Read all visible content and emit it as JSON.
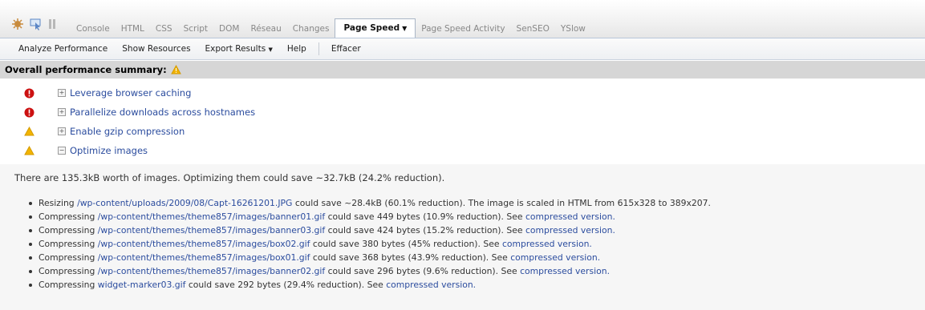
{
  "tabs": [
    "Console",
    "HTML",
    "CSS",
    "Script",
    "DOM",
    "Réseau",
    "Changes",
    "Page Speed",
    "Page Speed Activity",
    "SenSEO",
    "YSlow"
  ],
  "active_tab": "Page Speed",
  "toolbar": [
    "Analyze Performance",
    "Show Resources",
    "Export Results",
    "Help",
    "Effacer"
  ],
  "summary": {
    "title": "Overall performance summary:"
  },
  "rules": [
    {
      "label": "Leverage browser caching",
      "severity": "error",
      "expanded": false
    },
    {
      "label": "Parallelize downloads across hostnames",
      "severity": "error",
      "expanded": false
    },
    {
      "label": "Enable gzip compression",
      "severity": "warning",
      "expanded": false
    },
    {
      "label": "Optimize images",
      "severity": "warning",
      "expanded": true
    }
  ],
  "details": {
    "lead": "There are 135.3kB worth of images. Optimizing them could save ~32.7kB (24.2% reduction).",
    "items": [
      {
        "action": "Resizing",
        "path": "/wp-content/uploads/2009/08/Capt-16261201.JPG",
        "text": "could save ~28.4kB (60.1% reduction). The image is scaled in HTML from 615x328 to 389x207.",
        "link": ""
      },
      {
        "action": "Compressing",
        "path": "/wp-content/themes/theme857/images/banner01.gif",
        "text": "could save 449 bytes (10.9% reduction). See",
        "link": "compressed version."
      },
      {
        "action": "Compressing",
        "path": "/wp-content/themes/theme857/images/banner03.gif",
        "text": "could save 424 bytes (15.2% reduction). See",
        "link": "compressed version."
      },
      {
        "action": "Compressing",
        "path": "/wp-content/themes/theme857/images/box02.gif",
        "text": "could save 380 bytes (45% reduction). See",
        "link": "compressed version."
      },
      {
        "action": "Compressing",
        "path": "/wp-content/themes/theme857/images/box01.gif",
        "text": "could save 368 bytes (43.9% reduction). See",
        "link": "compressed version."
      },
      {
        "action": "Compressing",
        "path": "/wp-content/themes/theme857/images/banner02.gif",
        "text": "could save 296 bytes (9.6% reduction). See",
        "link": "compressed version."
      },
      {
        "action": "Compressing",
        "path": "widget-marker03.gif",
        "text": "could save 292 bytes (29.4% reduction). See",
        "link": "compressed version."
      }
    ]
  },
  "icons": {
    "toolbar": [
      "firebug-icon",
      "inspect-icon",
      "pause-icon"
    ],
    "error": "error-icon",
    "warning": "warning-icon"
  },
  "colors": {
    "error": "#cc1111",
    "warning": "#f2b400",
    "link": "#2b4c9e"
  }
}
